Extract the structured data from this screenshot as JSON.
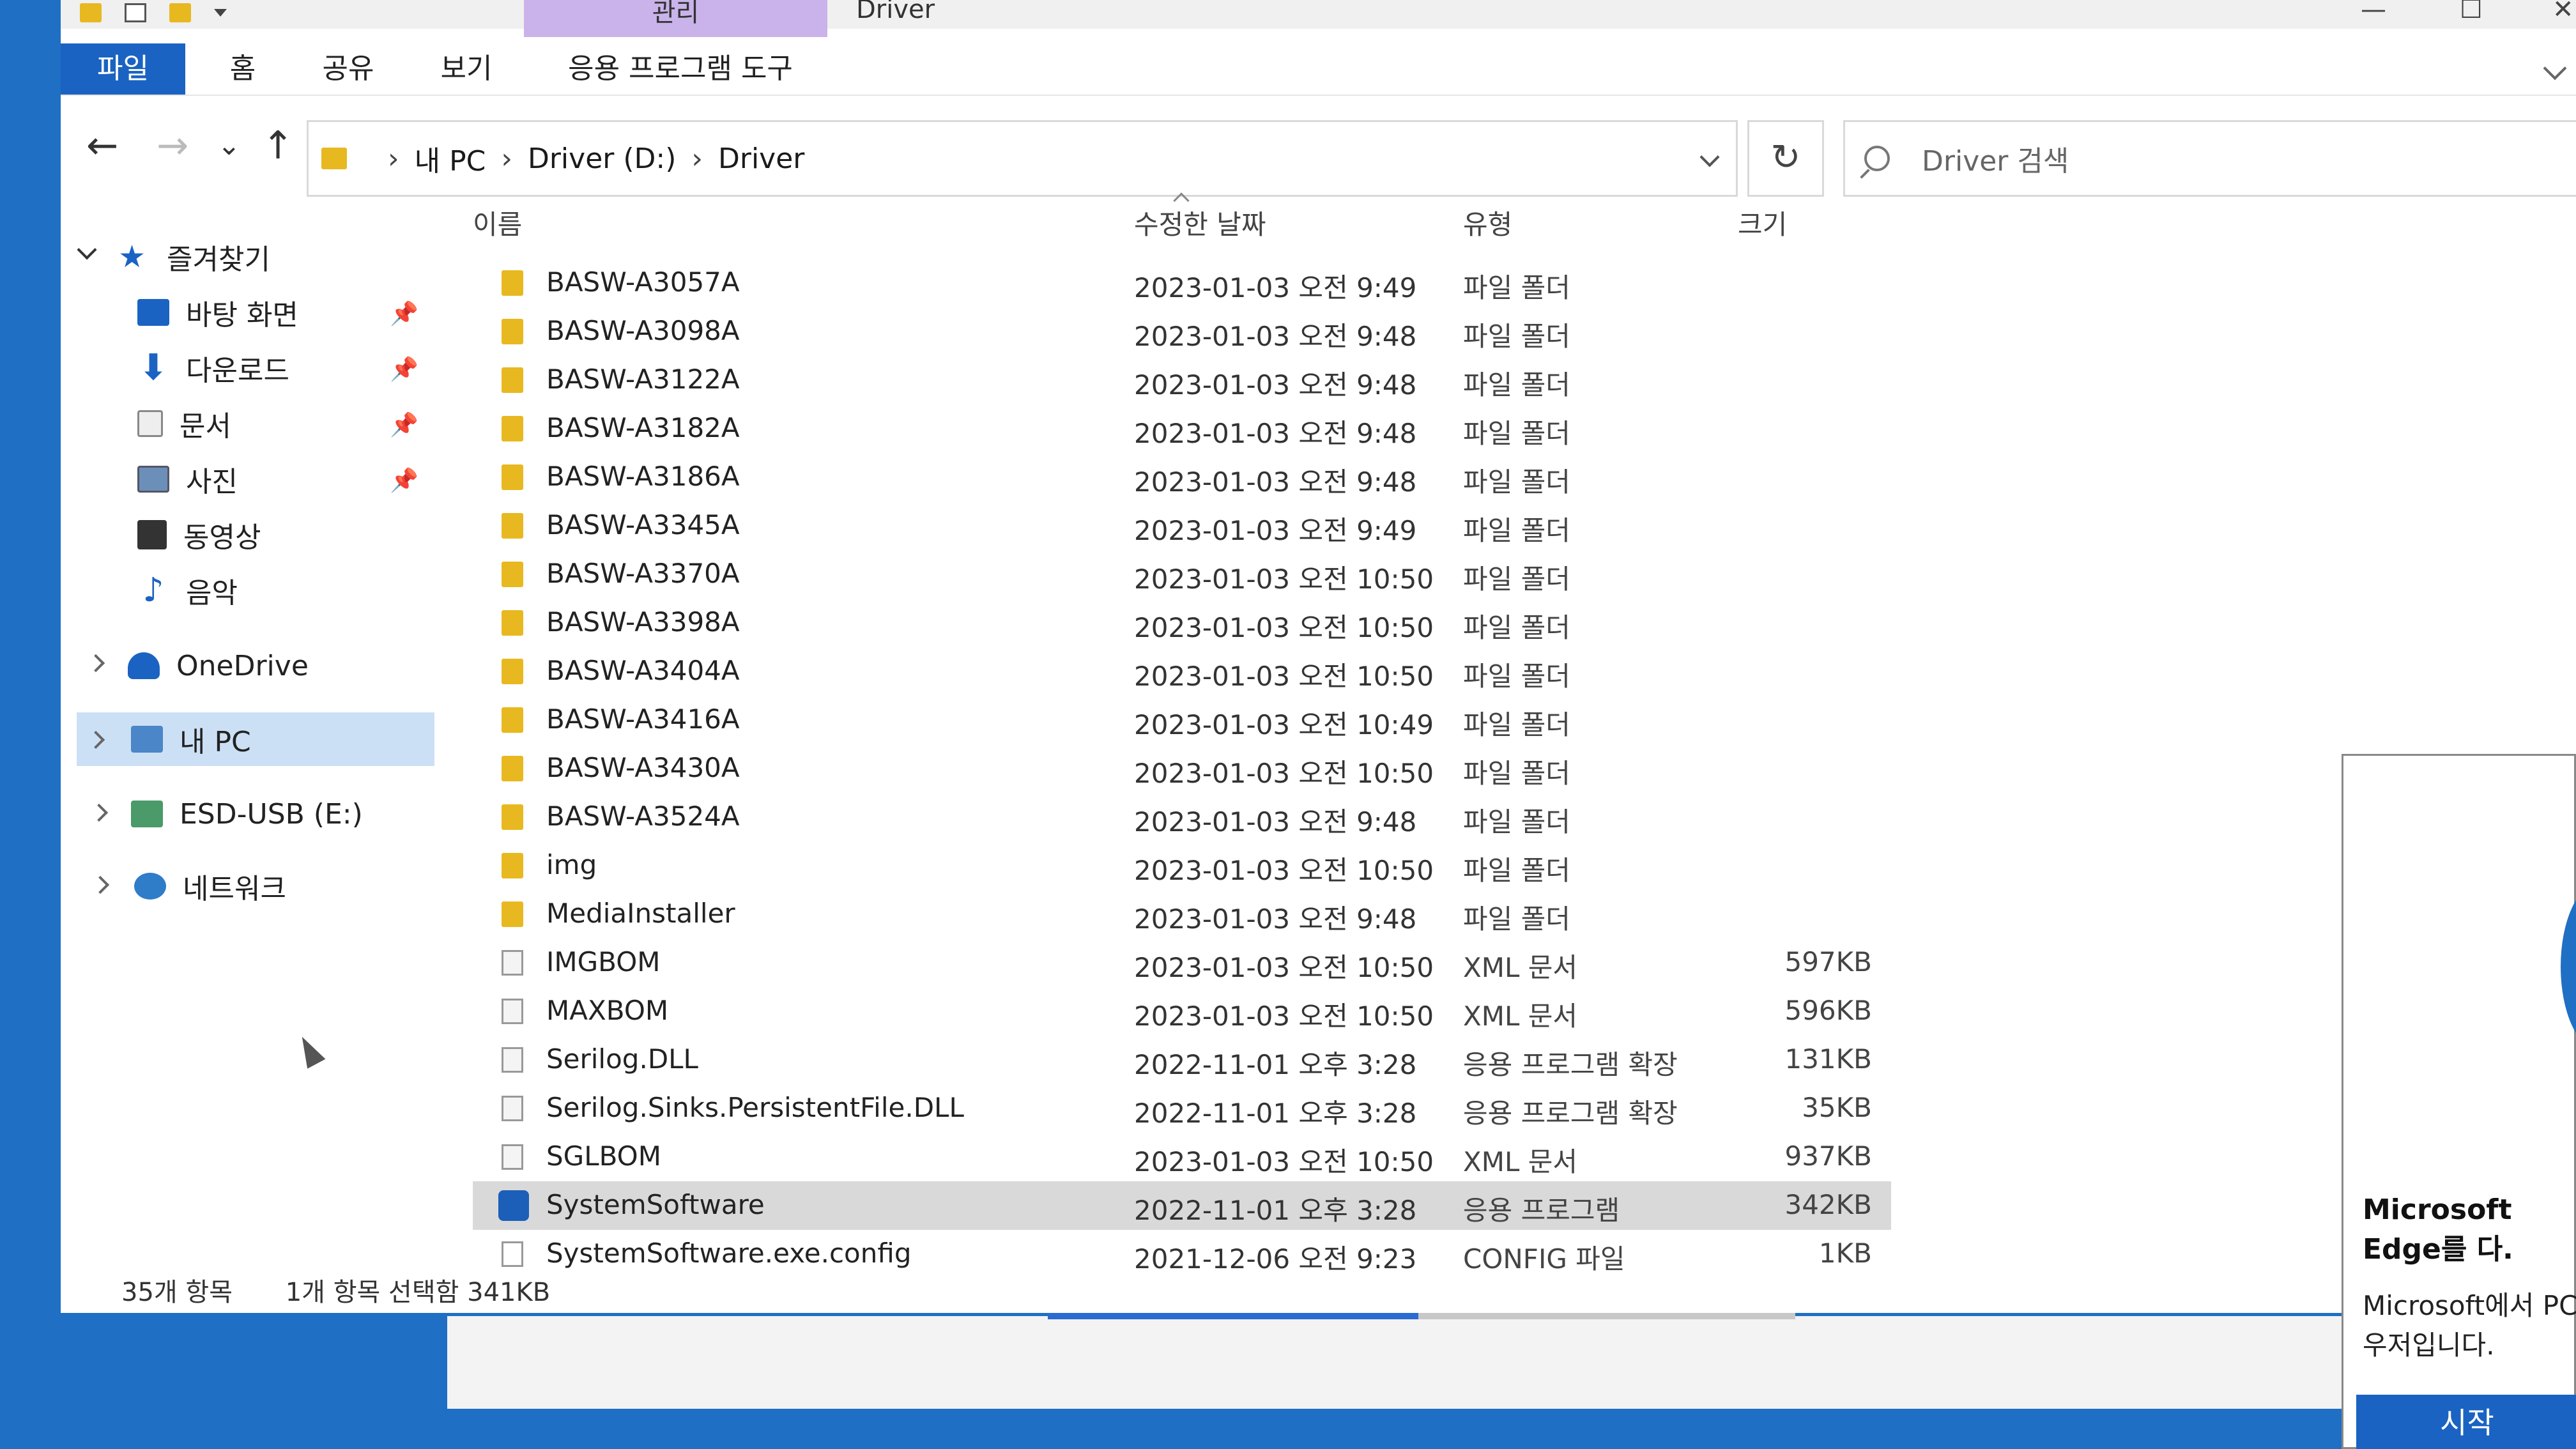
{
  "titlebar": {
    "manage_tab": "관리",
    "window_title": "Driver",
    "minimize": "—",
    "maximize": "☐",
    "close": "✕"
  },
  "ribbon": {
    "tabs": [
      "파일",
      "홈",
      "공유",
      "보기",
      "응용 프로그램 도구"
    ]
  },
  "nav": {
    "back": "←",
    "forward": "→",
    "recent": "⌄",
    "up": "↑",
    "breadcrumbs": [
      "내 PC",
      "Driver (D:)",
      "Driver"
    ],
    "refresh": "↻",
    "search_placeholder": "Driver 검색"
  },
  "sidebar": {
    "quick_access": "즐겨찾기",
    "items": [
      {
        "label": "바탕 화면",
        "icon": "desktop-icon",
        "pinned": true
      },
      {
        "label": "다운로드",
        "icon": "download-icon",
        "pinned": true
      },
      {
        "label": "문서",
        "icon": "document-icon",
        "pinned": true
      },
      {
        "label": "사진",
        "icon": "pictures-icon",
        "pinned": true
      },
      {
        "label": "동영상",
        "icon": "video-icon",
        "pinned": false
      },
      {
        "label": "음악",
        "icon": "music-icon",
        "pinned": false
      }
    ],
    "onedrive": "OneDrive",
    "this_pc": "내 PC",
    "usb": "ESD-USB (E:)",
    "network": "네트워크"
  },
  "columns": {
    "name": "이름",
    "date": "수정한 날짜",
    "type": "유형",
    "size": "크기"
  },
  "files": [
    {
      "name": "BASW-A3057A",
      "date": "2023-01-03 오전 9:49",
      "type": "파일 폴더",
      "size": "",
      "kind": "folder"
    },
    {
      "name": "BASW-A3098A",
      "date": "2023-01-03 오전 9:48",
      "type": "파일 폴더",
      "size": "",
      "kind": "folder"
    },
    {
      "name": "BASW-A3122A",
      "date": "2023-01-03 오전 9:48",
      "type": "파일 폴더",
      "size": "",
      "kind": "folder"
    },
    {
      "name": "BASW-A3182A",
      "date": "2023-01-03 오전 9:48",
      "type": "파일 폴더",
      "size": "",
      "kind": "folder"
    },
    {
      "name": "BASW-A3186A",
      "date": "2023-01-03 오전 9:48",
      "type": "파일 폴더",
      "size": "",
      "kind": "folder"
    },
    {
      "name": "BASW-A3345A",
      "date": "2023-01-03 오전 9:49",
      "type": "파일 폴더",
      "size": "",
      "kind": "folder"
    },
    {
      "name": "BASW-A3370A",
      "date": "2023-01-03 오전 10:50",
      "type": "파일 폴더",
      "size": "",
      "kind": "folder"
    },
    {
      "name": "BASW-A3398A",
      "date": "2023-01-03 오전 10:50",
      "type": "파일 폴더",
      "size": "",
      "kind": "folder"
    },
    {
      "name": "BASW-A3404A",
      "date": "2023-01-03 오전 10:50",
      "type": "파일 폴더",
      "size": "",
      "kind": "folder"
    },
    {
      "name": "BASW-A3416A",
      "date": "2023-01-03 오전 10:49",
      "type": "파일 폴더",
      "size": "",
      "kind": "folder"
    },
    {
      "name": "BASW-A3430A",
      "date": "2023-01-03 오전 10:50",
      "type": "파일 폴더",
      "size": "",
      "kind": "folder"
    },
    {
      "name": "BASW-A3524A",
      "date": "2023-01-03 오전 9:48",
      "type": "파일 폴더",
      "size": "",
      "kind": "folder"
    },
    {
      "name": "img",
      "date": "2023-01-03 오전 10:50",
      "type": "파일 폴더",
      "size": "",
      "kind": "folder"
    },
    {
      "name": "MediaInstaller",
      "date": "2023-01-03 오전 9:48",
      "type": "파일 폴더",
      "size": "",
      "kind": "folder"
    },
    {
      "name": "IMGBOM",
      "date": "2023-01-03 오전 10:50",
      "type": "XML 문서",
      "size": "597KB",
      "kind": "xml"
    },
    {
      "name": "MAXBOM",
      "date": "2023-01-03 오전 10:50",
      "type": "XML 문서",
      "size": "596KB",
      "kind": "xml"
    },
    {
      "name": "Serilog.DLL",
      "date": "2022-11-01 오후 3:28",
      "type": "응용 프로그램 확장",
      "size": "131KB",
      "kind": "dll"
    },
    {
      "name": "Serilog.Sinks.PersistentFile.DLL",
      "date": "2022-11-01 오후 3:28",
      "type": "응용 프로그램 확장",
      "size": "35KB",
      "kind": "dll"
    },
    {
      "name": "SGLBOM",
      "date": "2023-01-03 오전 10:50",
      "type": "XML 문서",
      "size": "937KB",
      "kind": "xml"
    },
    {
      "name": "SystemSoftware",
      "date": "2022-11-01 오후 3:28",
      "type": "응용 프로그램",
      "size": "342KB",
      "kind": "exe",
      "selected": true
    },
    {
      "name": "SystemSoftware.exe.config",
      "date": "2021-12-06 오전 9:23",
      "type": "CONFIG 파일",
      "size": "1KB",
      "kind": "cfg"
    }
  ],
  "status": {
    "count": "35개 항목",
    "selection": "1개 항목 선택함 341KB"
  },
  "edge_popup": {
    "title": "Microsoft Edge를 다.",
    "body": "Microsoft에서 PC 우저입니다.",
    "button": "시작"
  },
  "colors": {
    "accent": "#1a63c2",
    "manage_tab": "#c9b3ea",
    "folder": "#e8b820",
    "selection": "#cce0f5",
    "desktop": "#1f6fc4"
  }
}
